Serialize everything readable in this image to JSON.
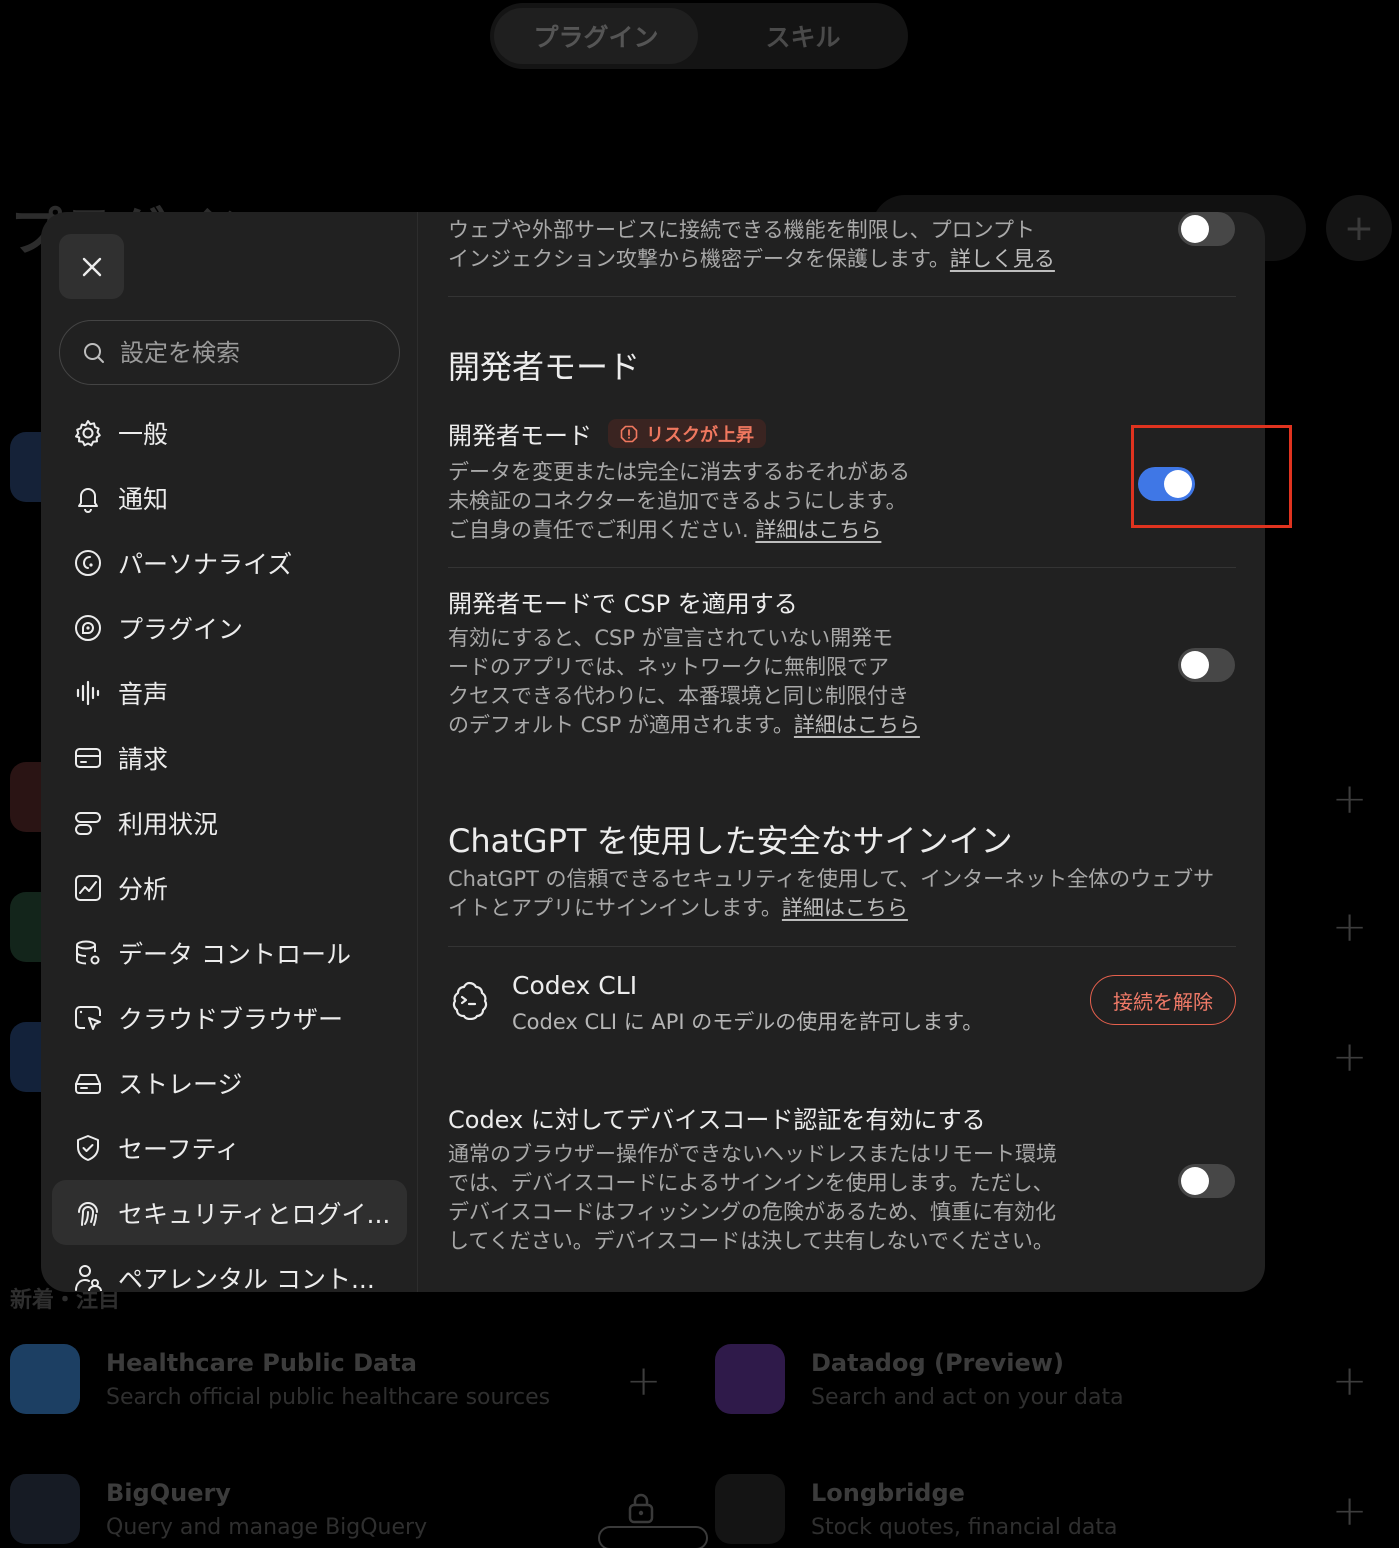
{
  "background": {
    "tabs": [
      "プラグイン",
      "スキル"
    ],
    "title_partial": "プラグイン",
    "section_label": "新着・注目",
    "apps": [
      {
        "name": "Healthcare Public Data",
        "desc": "Search official public healthcare sources"
      },
      {
        "name": "Datadog (Preview)",
        "desc": "Search and act on your data"
      },
      {
        "name": "BigQuery",
        "desc": "Query and manage BigQuery"
      },
      {
        "name": "Longbridge",
        "desc": "Stock quotes, financial data"
      }
    ]
  },
  "sidebar": {
    "search_placeholder": "設定を検索",
    "items": [
      {
        "label": "一般",
        "icon": "gear-icon"
      },
      {
        "label": "通知",
        "icon": "bell-icon"
      },
      {
        "label": "パーソナライズ",
        "icon": "personalize-icon"
      },
      {
        "label": "プラグイン",
        "icon": "plugin-icon"
      },
      {
        "label": "音声",
        "icon": "voice-icon"
      },
      {
        "label": "請求",
        "icon": "card-icon"
      },
      {
        "label": "利用状況",
        "icon": "usage-icon"
      },
      {
        "label": "分析",
        "icon": "chart-icon"
      },
      {
        "label": "データ コントロール",
        "icon": "database-icon"
      },
      {
        "label": "クラウドブラウザー",
        "icon": "cloud-browser-icon"
      },
      {
        "label": "ストレージ",
        "icon": "storage-icon"
      },
      {
        "label": "セーフティ",
        "icon": "shield-icon"
      },
      {
        "label": "セキュリティとログイ...",
        "icon": "security-icon",
        "active": true
      },
      {
        "label": "ペアレンタル コント...",
        "icon": "parental-icon"
      }
    ]
  },
  "content": {
    "top_desc_line1": "ウェブや外部サービスに接続できる機能を制限し、プロンプト",
    "top_desc_line2": "インジェクション攻撃から機密データを保護します。",
    "top_link": "詳しく見る",
    "dev_section_title": "開発者モード",
    "dev_mode": {
      "title": "開発者モード",
      "badge": "リスクが上昇",
      "line1": "データを変更または完全に消去するおそれがある",
      "line2": "未検証のコネクターを追加できるようにします。",
      "line3": "ご自身の責任でご利用ください.",
      "link": "詳細はこちら",
      "enabled": true
    },
    "csp": {
      "title": "開発者モードで CSP を適用する",
      "line1": "有効にすると、CSP が宣言されていない開発モ",
      "line2": "ードのアプリでは、ネットワークに無制限でア",
      "line3": "クセスできる代わりに、本番環境と同じ制限付き",
      "line4": "のデフォルト CSP が適用されます。",
      "link": "詳細はこちら",
      "enabled": false
    },
    "signin_section_title": "ChatGPT を使用した安全なサインイン",
    "signin_line1": "ChatGPT の信頼できるセキュリティを使用して、インターネット全体のウェブサ",
    "signin_line2": "イトとアプリにサインインします。",
    "signin_link": "詳細はこちら",
    "codex_cli": {
      "title": "Codex CLI",
      "desc": "Codex CLI に API のモデルの使用を許可します。",
      "button": "接続を解除"
    },
    "device_code": {
      "title": "Codex に対してデバイスコード認証を有効にする",
      "line1": "通常のブラウザー操作ができないヘッドレスまたはリモート環境",
      "line2": "では、デバイスコードによるサインインを使用します。ただし、",
      "line3": "デバイスコードはフィッシングの危険があるため、慎重に有効化",
      "line4": "してください。デバイスコードは決して共有しないでください。",
      "enabled": false
    }
  },
  "colors": {
    "toggle_on": "#3f77e6",
    "danger": "#e5604d",
    "highlight": "#e0331f"
  }
}
